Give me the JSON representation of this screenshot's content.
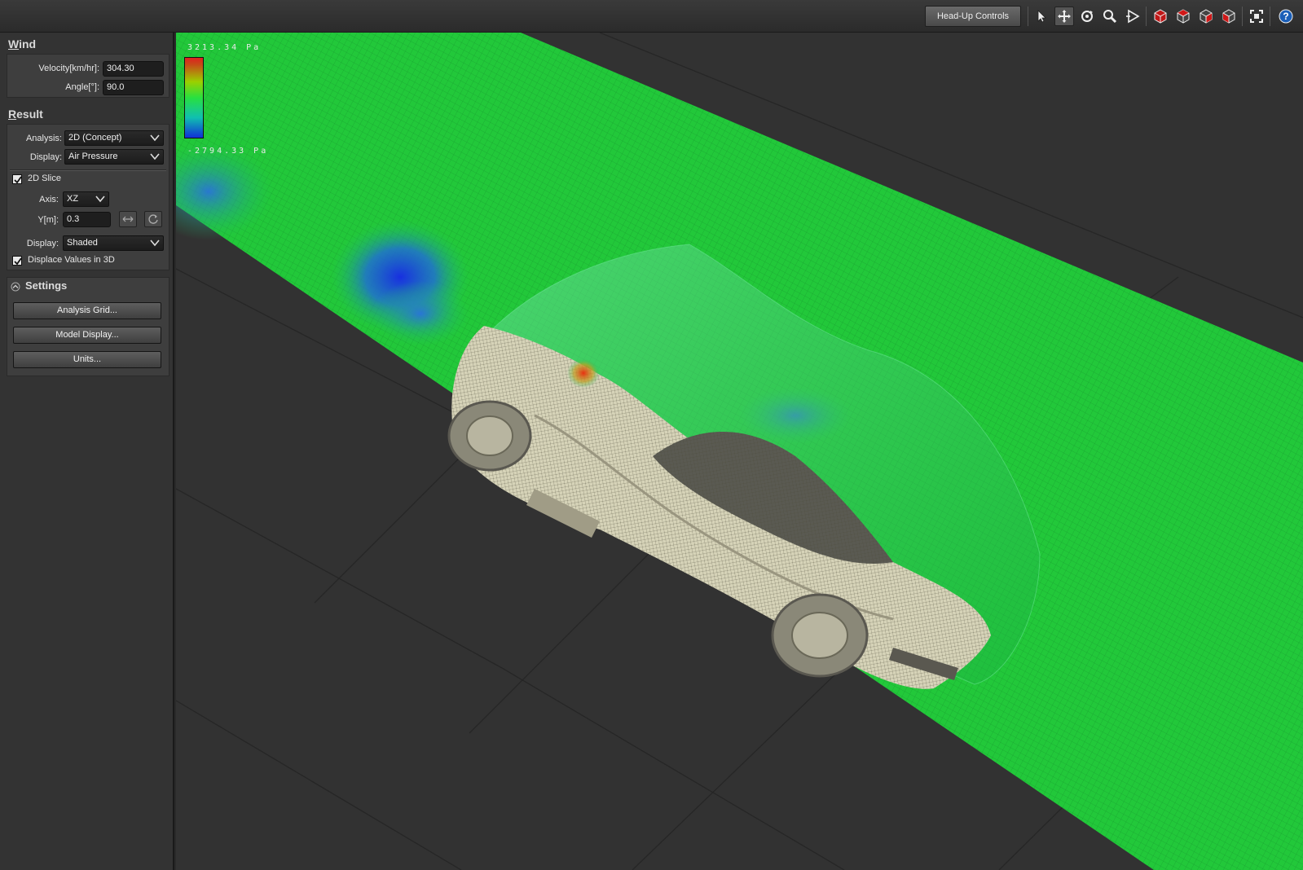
{
  "toolbar": {
    "head_up_controls": "Head-Up Controls",
    "tools": [
      {
        "icon": "select-arrow-icon"
      },
      {
        "icon": "pan-icon"
      },
      {
        "icon": "orbit-icon"
      },
      {
        "icon": "zoom-icon"
      },
      {
        "icon": "play-icon"
      },
      {
        "icon": "view-cube-front-icon"
      },
      {
        "icon": "view-cube-top-icon"
      },
      {
        "icon": "view-cube-right-icon"
      },
      {
        "icon": "view-cube-iso-icon"
      },
      {
        "icon": "fit-view-icon"
      },
      {
        "icon": "help-icon"
      }
    ]
  },
  "wind": {
    "title_first": "W",
    "title_rest": "ind",
    "velocity_label": "Velocity[km/hr]:",
    "velocity_value": "304.30",
    "angle_label": "Angle[°]:",
    "angle_value": "90.0"
  },
  "result": {
    "title_first": "R",
    "title_rest": "esult",
    "analysis_label": "Analysis:",
    "analysis_value": "2D (Concept)",
    "display_label": "Display:",
    "display_value": "Air Pressure",
    "slice_label": "2D Slice",
    "slice_checked": true,
    "axis_label": "Axis:",
    "axis_value": "XZ",
    "y_label": "Y[m]:",
    "y_value": "0.3",
    "shade_label": "Display:",
    "shade_value": "Shaded",
    "displace_label": "Displace Values in 3D",
    "displace_checked": true
  },
  "settings": {
    "title": "Settings",
    "buttons": [
      "Analysis Grid...",
      "Model Display...",
      "Units..."
    ]
  },
  "legend": {
    "max": "3213.34 Pa",
    "min": "-2794.33 Pa",
    "colors": [
      "#e02020",
      "#9bd000",
      "#28e040",
      "#10c0b0",
      "#1030d8"
    ]
  },
  "colors": {
    "slice_green": "#22c83a",
    "car_body": "#d6d3b8",
    "background": "#323232"
  }
}
